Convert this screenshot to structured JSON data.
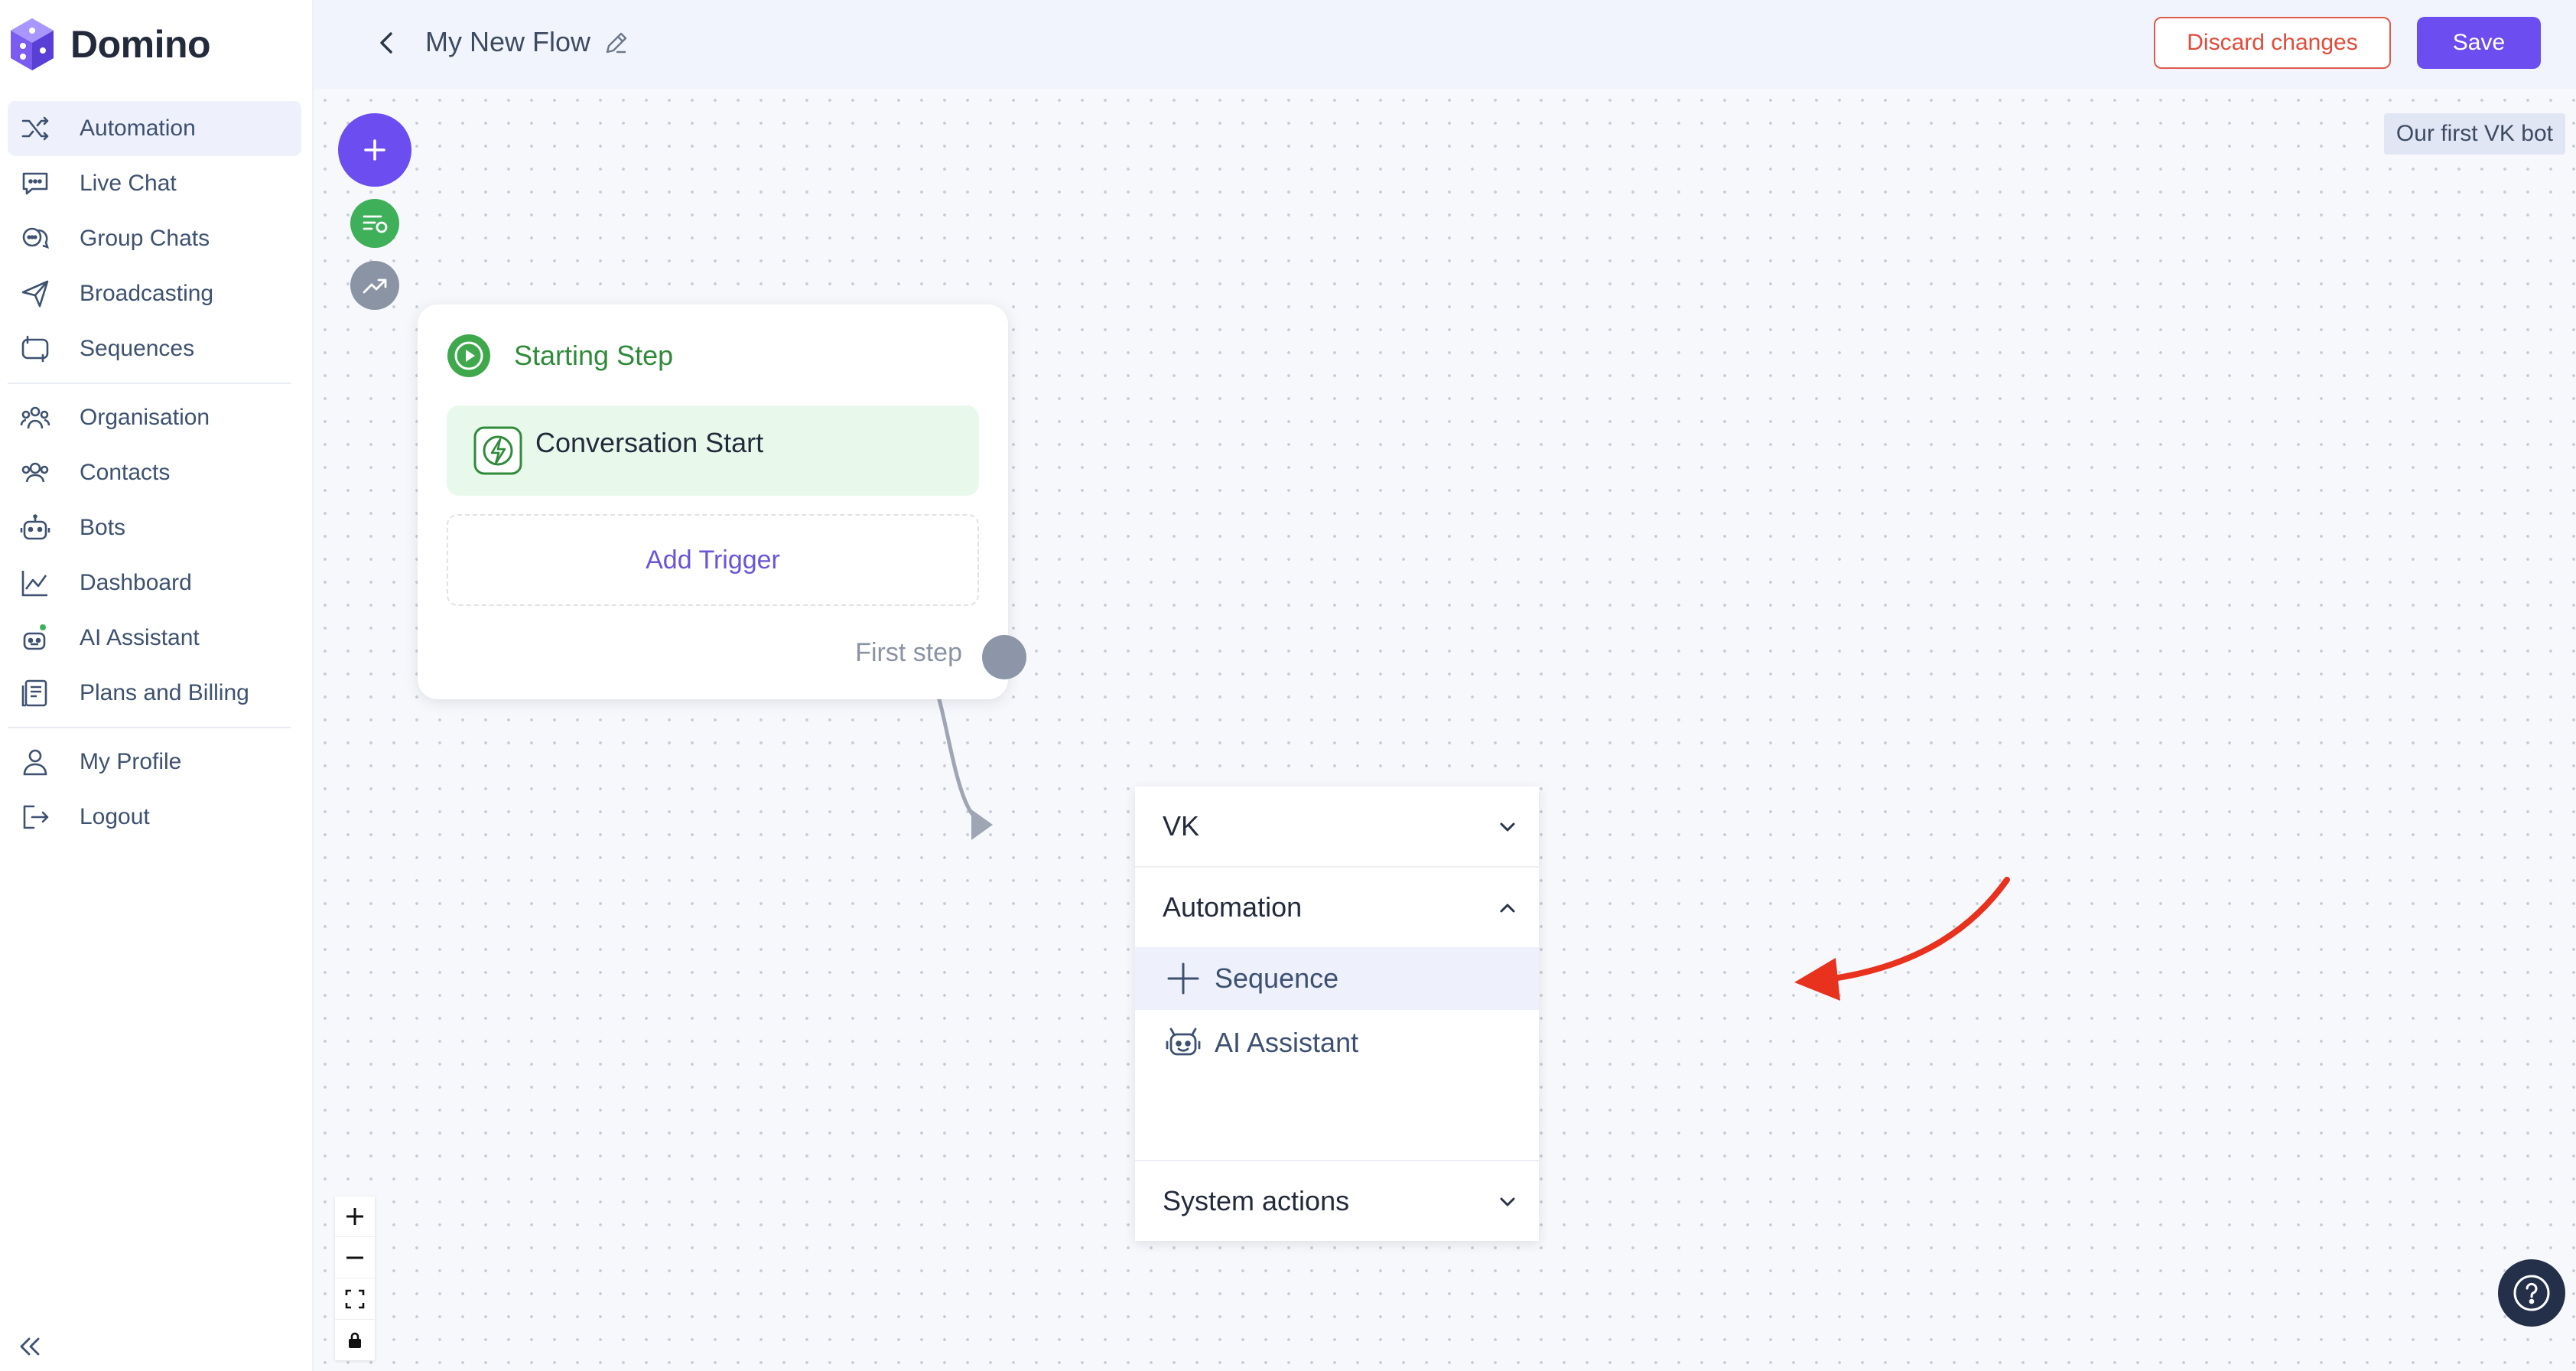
{
  "app": {
    "name": "Domino"
  },
  "sidebar": {
    "items": [
      {
        "label": "Automation",
        "icon": "shuffle-icon",
        "active": true
      },
      {
        "label": "Live Chat",
        "icon": "chat-bubble-icon"
      },
      {
        "label": "Group Chats",
        "icon": "group-chat-icon"
      },
      {
        "label": "Broadcasting",
        "icon": "send-icon"
      },
      {
        "label": "Sequences",
        "icon": "sequence-icon"
      },
      {
        "label": "Organisation",
        "icon": "organisation-icon"
      },
      {
        "label": "Contacts",
        "icon": "contacts-icon"
      },
      {
        "label": "Bots",
        "icon": "bot-icon"
      },
      {
        "label": "Dashboard",
        "icon": "chart-line-icon"
      },
      {
        "label": "AI Assistant",
        "icon": "ai-assistant-icon"
      },
      {
        "label": "Plans and Billing",
        "icon": "billing-icon"
      },
      {
        "label": "My Profile",
        "icon": "user-icon"
      },
      {
        "label": "Logout",
        "icon": "logout-icon"
      }
    ]
  },
  "header": {
    "title": "My New Flow",
    "discard_label": "Discard changes",
    "save_label": "Save"
  },
  "canvas": {
    "bot_tag": "Our first VK bot",
    "start_step": {
      "title": "Starting Step",
      "trigger": "Conversation Start",
      "add_trigger": "Add Trigger",
      "first_step": "First step"
    },
    "menu": {
      "sections": [
        {
          "label": "VK",
          "expanded": false
        },
        {
          "label": "Automation",
          "expanded": true
        },
        {
          "label": "System actions",
          "expanded": false
        }
      ],
      "automation_items": [
        {
          "label": "Sequence",
          "icon": "plus-icon",
          "highlighted": true
        },
        {
          "label": "AI Assistant",
          "icon": "ai-assistant-icon"
        }
      ]
    }
  },
  "colors": {
    "brand": "#6c4df0",
    "discard": "#e04b3a",
    "success": "#3fb05a",
    "annotation_arrow": "#e8321e"
  }
}
